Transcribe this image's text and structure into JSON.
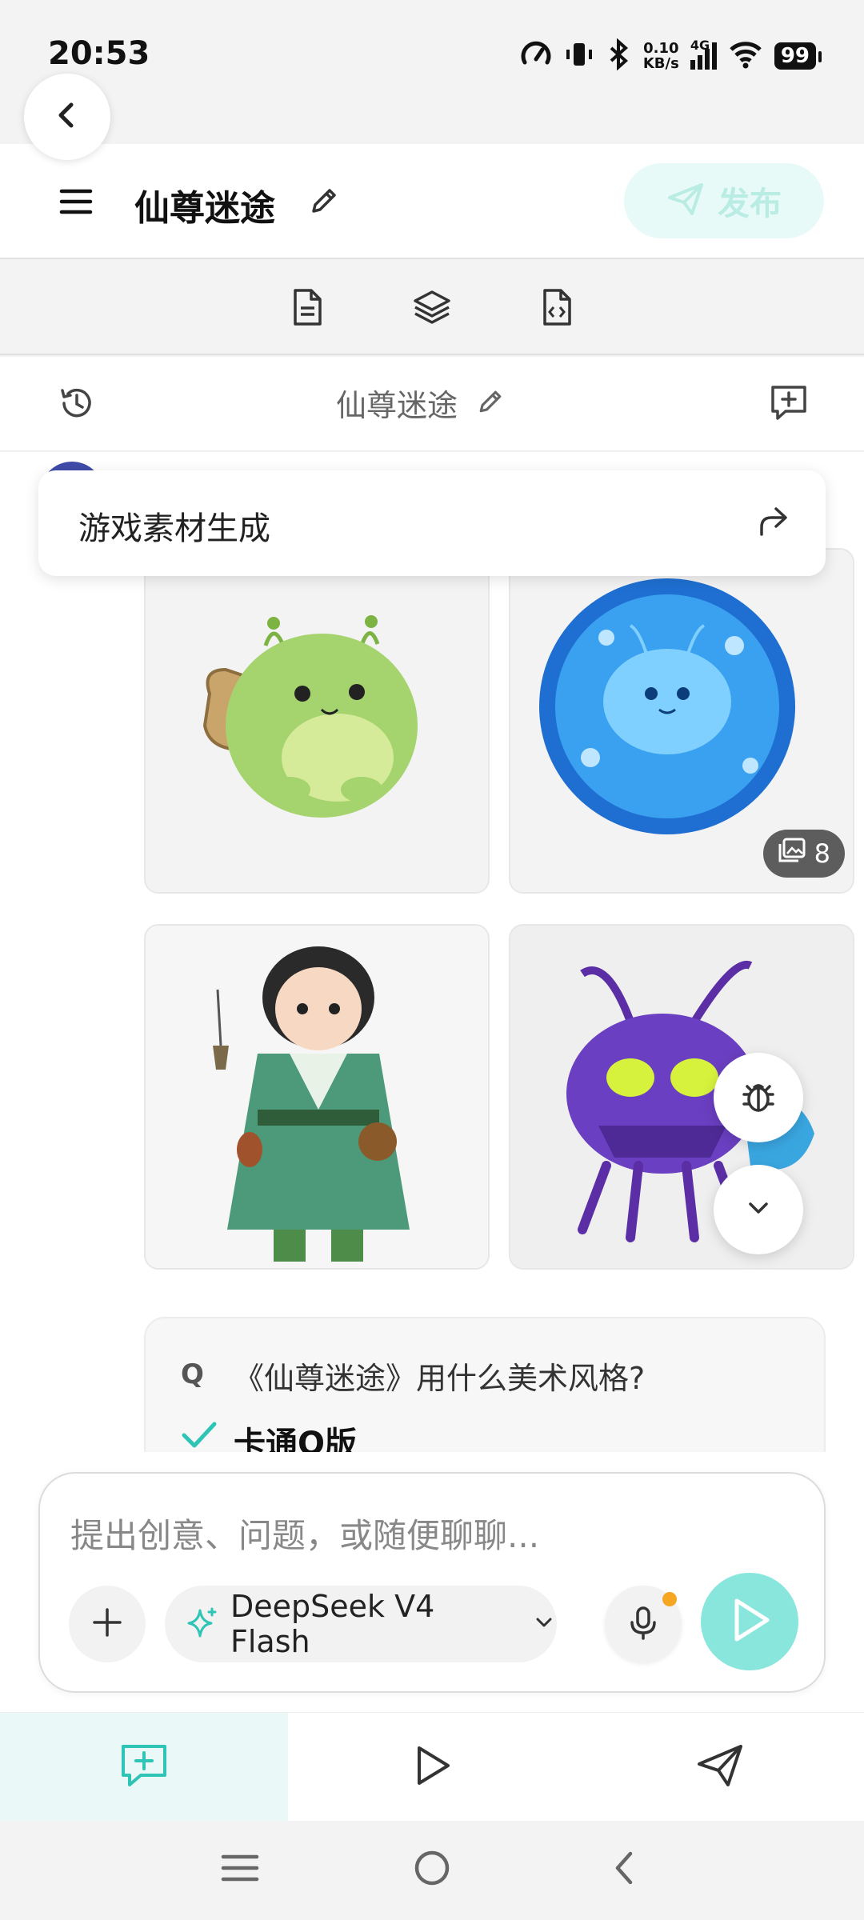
{
  "status_bar": {
    "time": "20:53",
    "net_speed_value": "0.10",
    "net_speed_unit": "KB/s",
    "network_type": "4G",
    "battery": "99"
  },
  "header": {
    "title": "仙尊迷途",
    "publish_label": "发布"
  },
  "chat_header": {
    "title": "仙尊迷途"
  },
  "skill": {
    "label": "游戏素材生成"
  },
  "images": [
    {
      "name": "green-bean-creature-with-sack"
    },
    {
      "name": "blue-water-sprite"
    },
    {
      "name": "young-cultivator-boy-in-green-robe"
    },
    {
      "name": "purple-armored-insect"
    }
  ],
  "image_count_badge": "8",
  "qa": {
    "q_marker": "Q",
    "question": "《仙尊迷途》用什么美术风格?",
    "answer": "卡通Q版"
  },
  "composer": {
    "placeholder": "提出创意、问题，或随便聊聊...",
    "model_label": "DeepSeek V4 Flash"
  },
  "colors": {
    "accent": "#2ec4b6",
    "send_bg": "#88e6dc",
    "publish_bg": "#e8faf7",
    "publish_text": "#b9ece3",
    "mic_dot": "#f5a623"
  },
  "icons": {
    "back": "chevron-left-icon",
    "menu": "hamburger-icon",
    "edit": "pencil-icon",
    "publish": "paper-plane-icon",
    "doc": "document-icon",
    "layers": "layers-icon",
    "code_file": "code-file-icon",
    "history": "history-icon",
    "new_chat": "chat-plus-icon",
    "share": "share-arrow-icon",
    "bug": "bug-icon",
    "scroll_down": "chevron-down-icon",
    "plus": "plus-icon",
    "sparkle": "sparkle-icon",
    "mic": "mic-icon",
    "send": "play-send-icon",
    "tab_chat": "chat-plus-icon",
    "tab_preview": "play-icon",
    "tab_publish": "paper-plane-icon"
  }
}
